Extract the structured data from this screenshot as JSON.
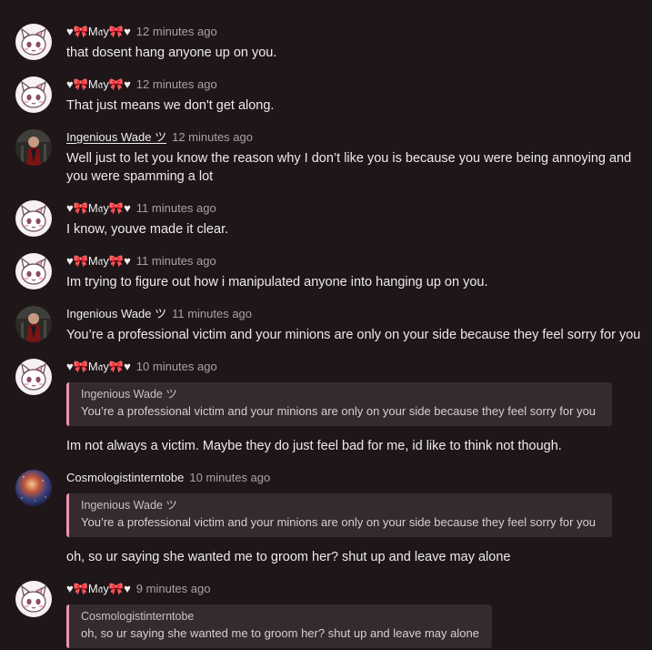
{
  "colors": {
    "background": "#1e1618",
    "quote_bar": "#ee94b5",
    "quote_bg": "#342b2f"
  },
  "messages": [
    {
      "avatar": "may-avatar",
      "author": "♥🎀M𝔞y🎀♥",
      "time": "12 minutes ago",
      "text": "that dosent hang anyone up on you."
    },
    {
      "avatar": "may-avatar",
      "author": "♥🎀M𝔞y🎀♥",
      "time": "12 minutes ago",
      "text": "That just means we don't get along."
    },
    {
      "avatar": "wade-avatar",
      "author": "Ingenious Wade ツ",
      "time": "12 minutes ago",
      "text": "Well just to let you know the reason why I don’t like you is because you were being annoying and you were spamming a lot"
    },
    {
      "avatar": "may-avatar",
      "author": "♥🎀M𝔞y🎀♥",
      "time": "11 minutes ago",
      "text": "I know, youve made it clear."
    },
    {
      "avatar": "may-avatar",
      "author": "♥🎀M𝔞y🎀♥",
      "time": "11 minutes ago",
      "text": "Im trying to figure out how i manipulated anyone into hanging up on you."
    },
    {
      "avatar": "wade-avatar",
      "author": "Ingenious Wade ツ",
      "time": "11 minutes ago",
      "text": "You’re a professional victim and your minions are only on your side because they feel sorry for you"
    },
    {
      "avatar": "may-avatar",
      "author": "♥🎀M𝔞y🎀♥",
      "time": "10 minutes ago",
      "quote": {
        "author": "Ingenious Wade ツ",
        "text": "You’re a professional victim and your minions are only on your side because they feel sorry for you"
      },
      "text": "Im not always a victim. Maybe they do just feel bad for me, id like to think not though."
    },
    {
      "avatar": "cosmo-avatar",
      "author": "Cosmologistinterntobe",
      "time": "10 minutes ago",
      "quote": {
        "author": "Ingenious Wade ツ",
        "text": "You’re a professional victim and your minions are only on your side because they feel sorry for you"
      },
      "text": "oh, so ur saying she wanted me to groom her? shut up and leave may alone"
    },
    {
      "avatar": "may-avatar",
      "author": "♥🎀M𝔞y🎀♥",
      "time": "9 minutes ago",
      "quote": {
        "author": "Cosmologistinterntobe",
        "text": "oh, so ur saying she wanted me to groom her? shut up and leave may alone"
      }
    }
  ]
}
